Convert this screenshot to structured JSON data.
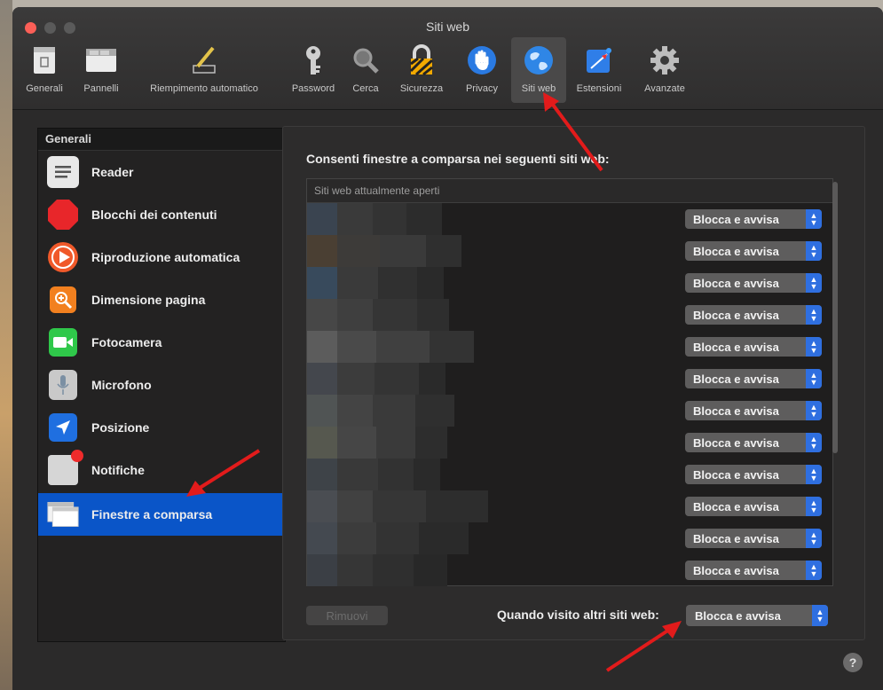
{
  "window": {
    "title": "Siti web"
  },
  "toolbar": {
    "items": [
      {
        "label": "Generali",
        "icon": "general-icon"
      },
      {
        "label": "Pannelli",
        "icon": "tabs-icon"
      },
      {
        "label": "Riempimento automatico",
        "icon": "autofill-pencil-icon"
      },
      {
        "label": "Password",
        "icon": "key-icon"
      },
      {
        "label": "Cerca",
        "icon": "search-icon"
      },
      {
        "label": "Sicurezza",
        "icon": "lock-icon"
      },
      {
        "label": "Privacy",
        "icon": "hand-icon"
      },
      {
        "label": "Siti web",
        "icon": "globe-icon",
        "selected": true
      },
      {
        "label": "Estensioni",
        "icon": "puzzle-icon"
      },
      {
        "label": "Avanzate",
        "icon": "gear-icon"
      }
    ]
  },
  "sidebar": {
    "header": "Generali",
    "items": [
      {
        "label": "Reader",
        "icon": "reader-icon"
      },
      {
        "label": "Blocchi dei contenuti",
        "icon": "stop-icon"
      },
      {
        "label": "Riproduzione automatica",
        "icon": "play-icon"
      },
      {
        "label": "Dimensione pagina",
        "icon": "zoom-icon"
      },
      {
        "label": "Fotocamera",
        "icon": "camera-icon"
      },
      {
        "label": "Microfono",
        "icon": "microphone-icon"
      },
      {
        "label": "Posizione",
        "icon": "location-icon"
      },
      {
        "label": "Notifiche",
        "icon": "notification-icon"
      },
      {
        "label": "Finestre a comparsa",
        "icon": "popup-window-icon",
        "selected": true
      }
    ]
  },
  "main": {
    "heading": "Consenti finestre a comparsa nei seguenti siti web:",
    "column_header": "Siti web attualmente aperti",
    "rows": [
      {
        "setting": "Blocca e avvisa"
      },
      {
        "setting": "Blocca e avvisa"
      },
      {
        "setting": "Blocca e avvisa"
      },
      {
        "setting": "Blocca e avvisa"
      },
      {
        "setting": "Blocca e avvisa"
      },
      {
        "setting": "Blocca e avvisa"
      },
      {
        "setting": "Blocca e avvisa"
      },
      {
        "setting": "Blocca e avvisa"
      },
      {
        "setting": "Blocca e avvisa"
      },
      {
        "setting": "Blocca e avvisa"
      },
      {
        "setting": "Blocca e avvisa"
      },
      {
        "setting": "Blocca e avvisa"
      }
    ],
    "remove_button": "Rimuovi",
    "other_sites_label": "Quando visito altri siti web:",
    "other_sites_setting": "Blocca e avvisa"
  },
  "help_button": "?",
  "colors": {
    "selection_blue": "#0a55c8",
    "popup_cap_blue": "#2f6fe0",
    "annotation_red": "#e21b1b"
  }
}
